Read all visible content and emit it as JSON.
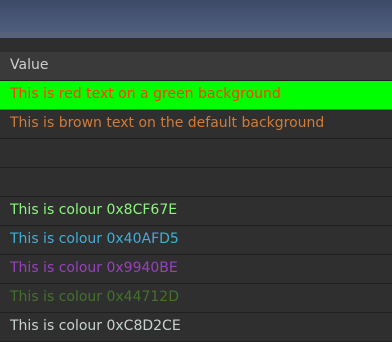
{
  "table": {
    "column_header": "Value",
    "rows": [
      {
        "text": "This is red text on a green background",
        "color": "#ff3b00",
        "background": "#00ff00"
      },
      {
        "text": "This is brown text on the default background",
        "color": "#d07c3a"
      },
      {
        "text": ""
      },
      {
        "text": ""
      },
      {
        "text": "This is colour 0x8CF67E",
        "color": "#8cf67e"
      },
      {
        "text": "This is colour 0x40AFD5",
        "color": "#40afd5"
      },
      {
        "text": "This is colour 0x9940BE",
        "color": "#9940be"
      },
      {
        "text": "This is colour 0x44712D",
        "color": "#44712d"
      },
      {
        "text": "This is colour 0xC8D2CE",
        "color": "#c8d2ce"
      }
    ]
  }
}
